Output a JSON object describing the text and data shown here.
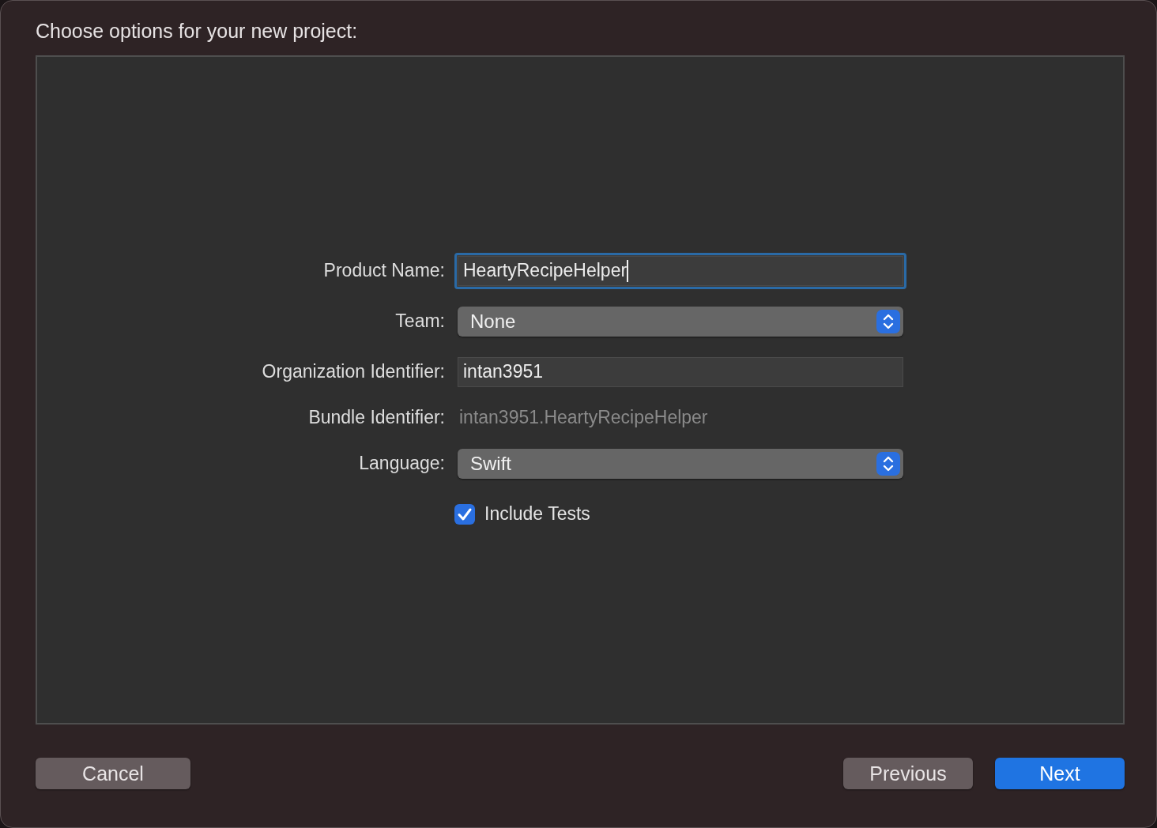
{
  "window": {
    "title": "Choose options for your new project:"
  },
  "fields": [
    {
      "kind": "text",
      "label": "Product Name:",
      "value": "HeartyRecipeHelper",
      "focused": true
    },
    {
      "kind": "popup",
      "label": "Team:",
      "value": "None"
    },
    {
      "kind": "text",
      "label": "Organization Identifier:",
      "value": "intan3951",
      "focused": false
    },
    {
      "kind": "static",
      "label": "Bundle Identifier:",
      "value": "intan3951.HeartyRecipeHelper"
    },
    {
      "kind": "popup",
      "label": "Language:",
      "value": "Swift"
    },
    {
      "kind": "checkbox",
      "label": "Include Tests",
      "checked": true
    }
  ],
  "buttons": [
    {
      "label": "Cancel",
      "default": false
    },
    {
      "label": "Previous",
      "default": false
    },
    {
      "label": "Next",
      "default": true
    }
  ]
}
